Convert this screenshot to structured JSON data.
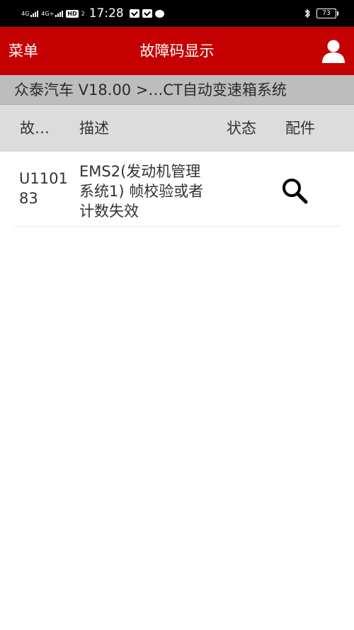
{
  "status_bar": {
    "signal1": "4G",
    "signal2": "4G+",
    "hd_badge": "HD",
    "hd_sub": "2",
    "time": "17:28",
    "battery": "73"
  },
  "header": {
    "menu_label": "菜单",
    "title": "故障码显示"
  },
  "breadcrumb": {
    "text": "众泰汽车 V18.00 >…CT自动变速箱系统"
  },
  "table": {
    "columns": [
      "故…",
      "描述",
      "状态",
      "配件"
    ],
    "rows": [
      {
        "code": "U110183",
        "description": "EMS2(发动机管理系统1) 帧校验或者计数失效",
        "status": ""
      }
    ]
  }
}
